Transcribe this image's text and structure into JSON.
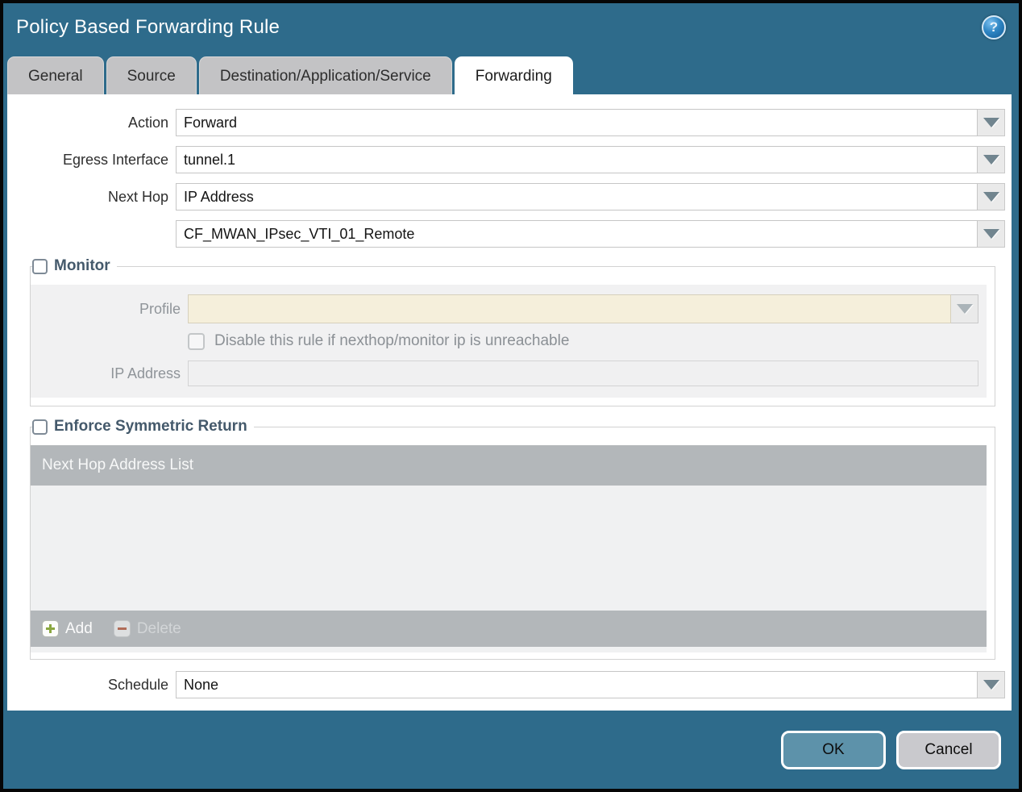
{
  "dialog": {
    "title": "Policy Based Forwarding Rule"
  },
  "tabs": [
    {
      "label": "General",
      "active": false
    },
    {
      "label": "Source",
      "active": false
    },
    {
      "label": "Destination/Application/Service",
      "active": false
    },
    {
      "label": "Forwarding",
      "active": true
    }
  ],
  "form": {
    "action": {
      "label": "Action",
      "value": "Forward"
    },
    "egress_interface": {
      "label": "Egress Interface",
      "value": "tunnel.1"
    },
    "next_hop": {
      "label": "Next Hop",
      "value": "IP Address"
    },
    "next_hop_address": {
      "value": "CF_MWAN_IPsec_VTI_01_Remote"
    },
    "monitor": {
      "label": "Monitor",
      "checked": false,
      "profile": {
        "label": "Profile",
        "value": ""
      },
      "disable_rule": {
        "label": "Disable this rule if nexthop/monitor ip is unreachable",
        "checked": false
      },
      "ip_address": {
        "label": "IP Address",
        "value": ""
      }
    },
    "enforce_symmetric_return": {
      "label": "Enforce Symmetric Return",
      "checked": false,
      "table": {
        "header": "Next Hop Address List",
        "rows": [],
        "add_label": "Add",
        "delete_label": "Delete"
      }
    },
    "schedule": {
      "label": "Schedule",
      "value": "None"
    }
  },
  "footer": {
    "ok_label": "OK",
    "cancel_label": "Cancel"
  },
  "colors": {
    "chrome_teal": "#2e6b8b",
    "active_tab": "#ffffff",
    "inactive_tab": "#c3c3c5",
    "section_label": "#44596b",
    "disabled_field_beige": "#f5efdb",
    "table_bar_gray": "#b3b7ba",
    "ok_button": "#5d92aa",
    "cancel_button": "#c9c9cd"
  }
}
